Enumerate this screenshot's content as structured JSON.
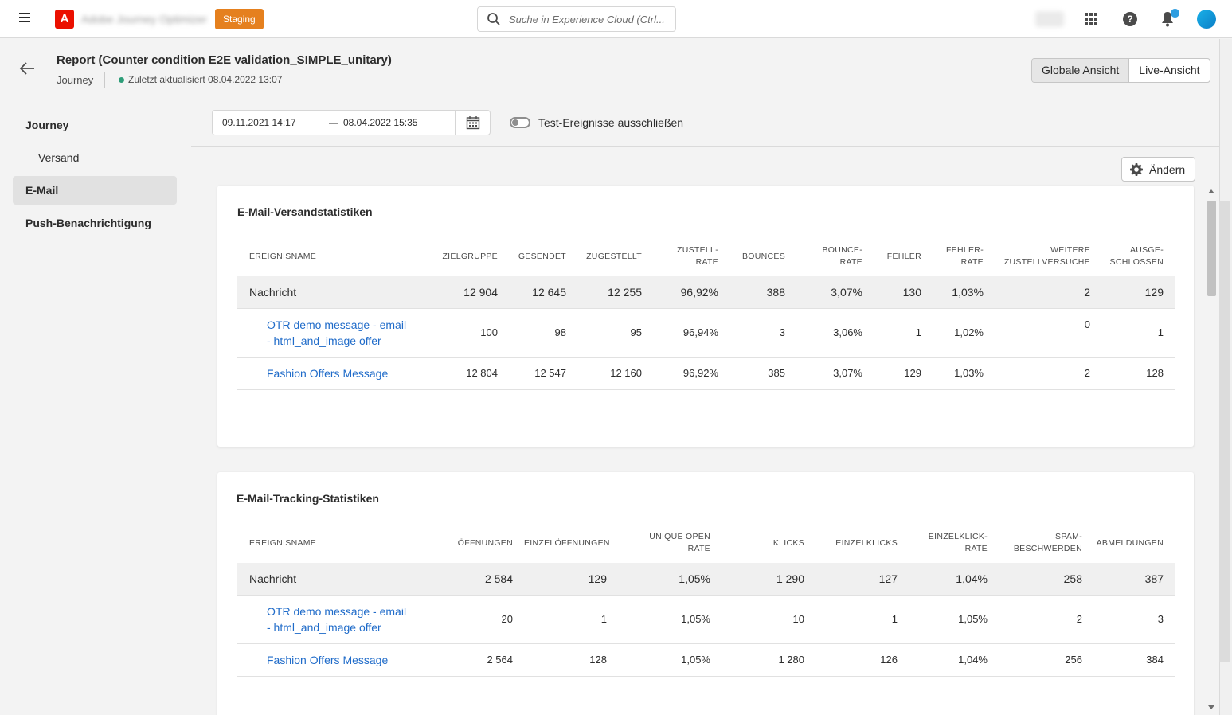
{
  "shell": {
    "app_name": "Adobe Journey Optimizer",
    "environment": "Staging",
    "search_placeholder": "Suche in Experience Cloud (Ctrl..."
  },
  "header": {
    "title": "Report (Counter condition E2E validation_SIMPLE_unitary)",
    "subtitle": "Journey",
    "status": "Zuletzt aktualisiert 08.04.2022 13:07",
    "view_global": "Globale Ansicht",
    "view_live": "Live-Ansicht"
  },
  "nav": {
    "items": [
      {
        "label": "Journey"
      },
      {
        "label": "Versand"
      },
      {
        "label": "E-Mail"
      },
      {
        "label": "Push-Benachrichtigung"
      }
    ]
  },
  "filter": {
    "start_date": "09.11.2021 14:17",
    "dash": "—",
    "end_date": "08.04.2022 15:35",
    "exclude_test_label": "Test-Ereignisse ausschließen"
  },
  "edit_label": "Ändern",
  "delivery": {
    "title": "E-Mail-Versandstatistiken",
    "headers": [
      "EREIGNISNAME",
      "ZIELGRUPPE",
      "GESENDET",
      "ZUGESTELLT",
      "ZUSTELL-\nRATE",
      "BOUNCES",
      "BOUNCE-\nRATE",
      "FEHLER",
      "FEHLER-\nRATE",
      "WEITERE\nZUSTELLVERSUCHE",
      "AUSGE-\nSCHLOSSEN"
    ],
    "rows": [
      [
        "Nachricht",
        "12 904",
        "12 645",
        "12 255",
        "96,92%",
        "388",
        "3,07%",
        "130",
        "1,03%",
        "2",
        "129"
      ],
      [
        "OTR demo message - email - html_and_image offer",
        "100",
        "98",
        "95",
        "96,94%",
        "3",
        "3,06%",
        "1",
        "1,02%",
        "0",
        "1"
      ],
      [
        "Fashion Offers Message",
        "12 804",
        "12 547",
        "12 160",
        "96,92%",
        "385",
        "3,07%",
        "129",
        "1,03%",
        "2",
        "128"
      ]
    ]
  },
  "tracking": {
    "title": "E-Mail-Tracking-Statistiken",
    "headers": [
      "EREIGNISNAME",
      "ÖFFNUNGEN",
      "EINZELÖFFNUNGEN",
      "UNIQUE OPEN\nRATE",
      "KLICKS",
      "EINZELKLICKS",
      "EINZELKLICK-\nRATE",
      "SPAM-\nBESCHWERDEN",
      "ABMELDUNGEN"
    ],
    "rows": [
      [
        "Nachricht",
        "2 584",
        "129",
        "1,05%",
        "1 290",
        "127",
        "1,04%",
        "258",
        "387"
      ],
      [
        "OTR demo message - email - html_and_image offer",
        "20",
        "1",
        "1,05%",
        "10",
        "1",
        "1,05%",
        "2",
        "3"
      ],
      [
        "Fashion Offers Message",
        "2 564",
        "128",
        "1,05%",
        "1 280",
        "126",
        "1,04%",
        "256",
        "384"
      ]
    ]
  }
}
